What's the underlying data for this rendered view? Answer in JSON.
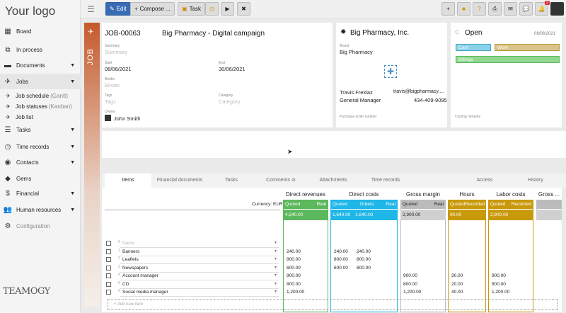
{
  "brand": {
    "logo_text": "Your logo",
    "bottom_logo": "TEAMOGY"
  },
  "sidebar": {
    "items": [
      {
        "label": "Board",
        "icon": "grid-icon"
      },
      {
        "label": "In process",
        "icon": "sitemap-icon"
      },
      {
        "label": "Documents",
        "icon": "folder-icon",
        "caret": true
      },
      {
        "label": "Jobs",
        "icon": "rocket-icon",
        "caret": true
      },
      {
        "label": "Tasks",
        "icon": "tasks-icon",
        "caret": true
      },
      {
        "label": "Time records",
        "icon": "clock-icon",
        "caret": true
      },
      {
        "label": "Contacts",
        "icon": "contacts-icon",
        "caret": true
      },
      {
        "label": "Gems",
        "icon": "gem-icon"
      },
      {
        "label": "Financial",
        "icon": "dollar-icon",
        "caret": true
      },
      {
        "label": "Human resources",
        "icon": "users-icon",
        "caret": true
      },
      {
        "label": "Configuration",
        "icon": "gear-icon"
      }
    ],
    "subitems": [
      {
        "label": "Job schedule",
        "muted": "(Gantt)"
      },
      {
        "label": "Job statuses",
        "muted": "(Kanban)"
      },
      {
        "label": "Job list",
        "muted": ""
      }
    ]
  },
  "toolbar": {
    "edit": "Edit",
    "compose": "Compose ...",
    "task": "Task",
    "notif_count": "3"
  },
  "job": {
    "vertical_label": "JOB",
    "code": "JOB-00063",
    "name": "Big Pharmacy - Digital campaign",
    "summary_label": "Summary",
    "summary_ph": "Summary",
    "start_label": "Start",
    "start": "08/06/2021",
    "end_label": "End",
    "end": "30/06/2021",
    "binder_label": "Binder",
    "binder_ph": "Binder",
    "tags_label": "Tags",
    "tags_ph": "Tags",
    "category_label": "Category",
    "category_ph": "Category",
    "owner_label": "Owner",
    "owner": "John Smith"
  },
  "client": {
    "name": "Big Pharmacy, Inc.",
    "brand_label": "Brand",
    "brand": "Big Pharmacy",
    "contact_name": "Travis Freklaz",
    "contact_email": "travis@bigpharmacy....",
    "contact_role": "General Manager",
    "contact_phone": "434-409-9095",
    "po_label": "Purchase order number"
  },
  "status": {
    "label": "Open",
    "date": "08/06/2021",
    "tags": [
      {
        "label": "Cost",
        "color": "#8ad2ea",
        "border": "#4aa8c8"
      },
      {
        "label": "Work",
        "color": "#d9c48a",
        "border": "#b89c44"
      },
      {
        "label": "Billings",
        "color": "#90d890",
        "border": "#5cb85c"
      }
    ],
    "closing_label": "Closing remarks"
  },
  "tabs": [
    "Items",
    "Financial documents",
    "Tasks",
    "Comments",
    "Attachments",
    "Time records",
    "Access",
    "History"
  ],
  "grid": {
    "currency": "Currency: EUR",
    "groups": [
      {
        "title": "Direct revenues",
        "sub1": "Quoted",
        "sub2": "Real",
        "total": "4,540.00",
        "color": "#5cb85c"
      },
      {
        "title": "Direct costs",
        "sub1": "Quoted",
        "sub2": "Orders",
        "sub3": "Real",
        "total1": "1,640.00",
        "total2": "1,640.00",
        "color": "#1fb6e8"
      },
      {
        "title": "Gross margin",
        "sub1": "Quoted",
        "sub2": "Real",
        "total": "2,900.00",
        "color": "#bbbbbb"
      },
      {
        "title": "Hours",
        "sub1": "Quoted",
        "sub2": "Recorded",
        "total": "90.00",
        "color": "#c9990c"
      },
      {
        "title": "Labor costs",
        "sub1": "Quoted",
        "sub2": "Recorded",
        "total": "2,900.00",
        "color": "#c9990c"
      },
      {
        "title": "Gross ...",
        "color": "#bbbbbb"
      }
    ],
    "rows": [
      {
        "n": "0",
        "name": "",
        "ph": "Name",
        "rev": "",
        "cq": "",
        "co": "",
        "gm": "",
        "h": "",
        "lc": ""
      },
      {
        "n": "1",
        "name": "Banners",
        "rev": "240.00",
        "cq": "240.00",
        "co": "240.00",
        "gm": "",
        "h": "",
        "lc": ""
      },
      {
        "n": "2",
        "name": "Leaflets",
        "rev": "800.00",
        "cq": "800.00",
        "co": "800.00",
        "gm": "",
        "h": "",
        "lc": ""
      },
      {
        "n": "3",
        "name": "Newspapers",
        "rev": "600.00",
        "cq": "600.00",
        "co": "600.00",
        "gm": "",
        "h": "",
        "lc": ""
      },
      {
        "n": "4",
        "name": "Account manager",
        "rev": "900.00",
        "cq": "",
        "co": "",
        "gm": "900.00",
        "h": "30.00",
        "lc": "900.00"
      },
      {
        "n": "5",
        "name": "CD",
        "rev": "800.00",
        "cq": "",
        "co": "",
        "gm": "800.00",
        "h": "20.00",
        "lc": "800.00"
      },
      {
        "n": "6",
        "name": "Social media manager",
        "rev": "1,200.00",
        "cq": "",
        "co": "",
        "gm": "1,200.00",
        "h": "40.00",
        "lc": "1,200.00"
      }
    ],
    "add_label": "+ Add new item"
  }
}
